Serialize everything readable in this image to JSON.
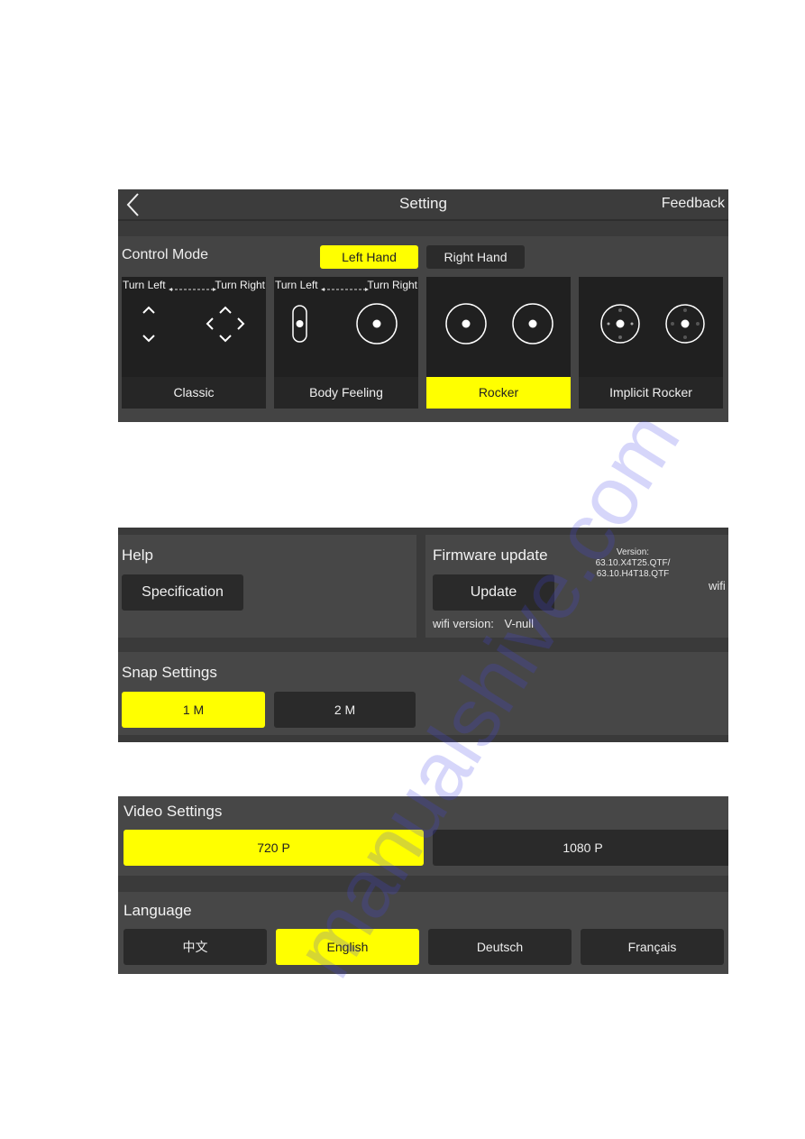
{
  "header": {
    "title": "Setting",
    "back_icon": "chevron-left-icon",
    "feedback_label": "Feedback"
  },
  "control_mode": {
    "label": "Control Mode",
    "hand_options": [
      {
        "label": "Left Hand",
        "selected": true
      },
      {
        "label": "Right Hand",
        "selected": false
      }
    ],
    "turn_left": "Turn Left",
    "turn_right": "Turn Right",
    "modes": [
      {
        "label": "Classic",
        "selected": false
      },
      {
        "label": "Body Feeling",
        "selected": false
      },
      {
        "label": "Rocker",
        "selected": true
      },
      {
        "label": "Implicit Rocker",
        "selected": false
      }
    ]
  },
  "help": {
    "title": "Help",
    "specification_label": "Specification"
  },
  "firmware": {
    "title": "Firmware update",
    "version_line1": "Version: 63.10.X4T25.QTF/",
    "version_line2": "63.10.H4T18.QTF",
    "update_label": "Update",
    "wifi_version_label": "wifi version:",
    "wifi_version_value": "V-null",
    "wifi_truncated": "wifi"
  },
  "snap": {
    "title": "Snap Settings",
    "options": [
      {
        "label": "1 M",
        "selected": true
      },
      {
        "label": "2 M",
        "selected": false
      }
    ]
  },
  "video": {
    "title": "Video Settings",
    "options": [
      {
        "label": "720 P",
        "selected": true
      },
      {
        "label": "1080 P",
        "selected": false
      }
    ]
  },
  "language": {
    "title": "Language",
    "options": [
      {
        "label": "中文",
        "selected": false
      },
      {
        "label": "English",
        "selected": true
      },
      {
        "label": "Deutsch",
        "selected": false
      },
      {
        "label": "Français",
        "selected": false
      }
    ]
  },
  "colors": {
    "accent": "#ffff00",
    "panel_bg": "#444444",
    "button_dark": "#2a2a2a"
  },
  "watermark": "manualshive.com"
}
